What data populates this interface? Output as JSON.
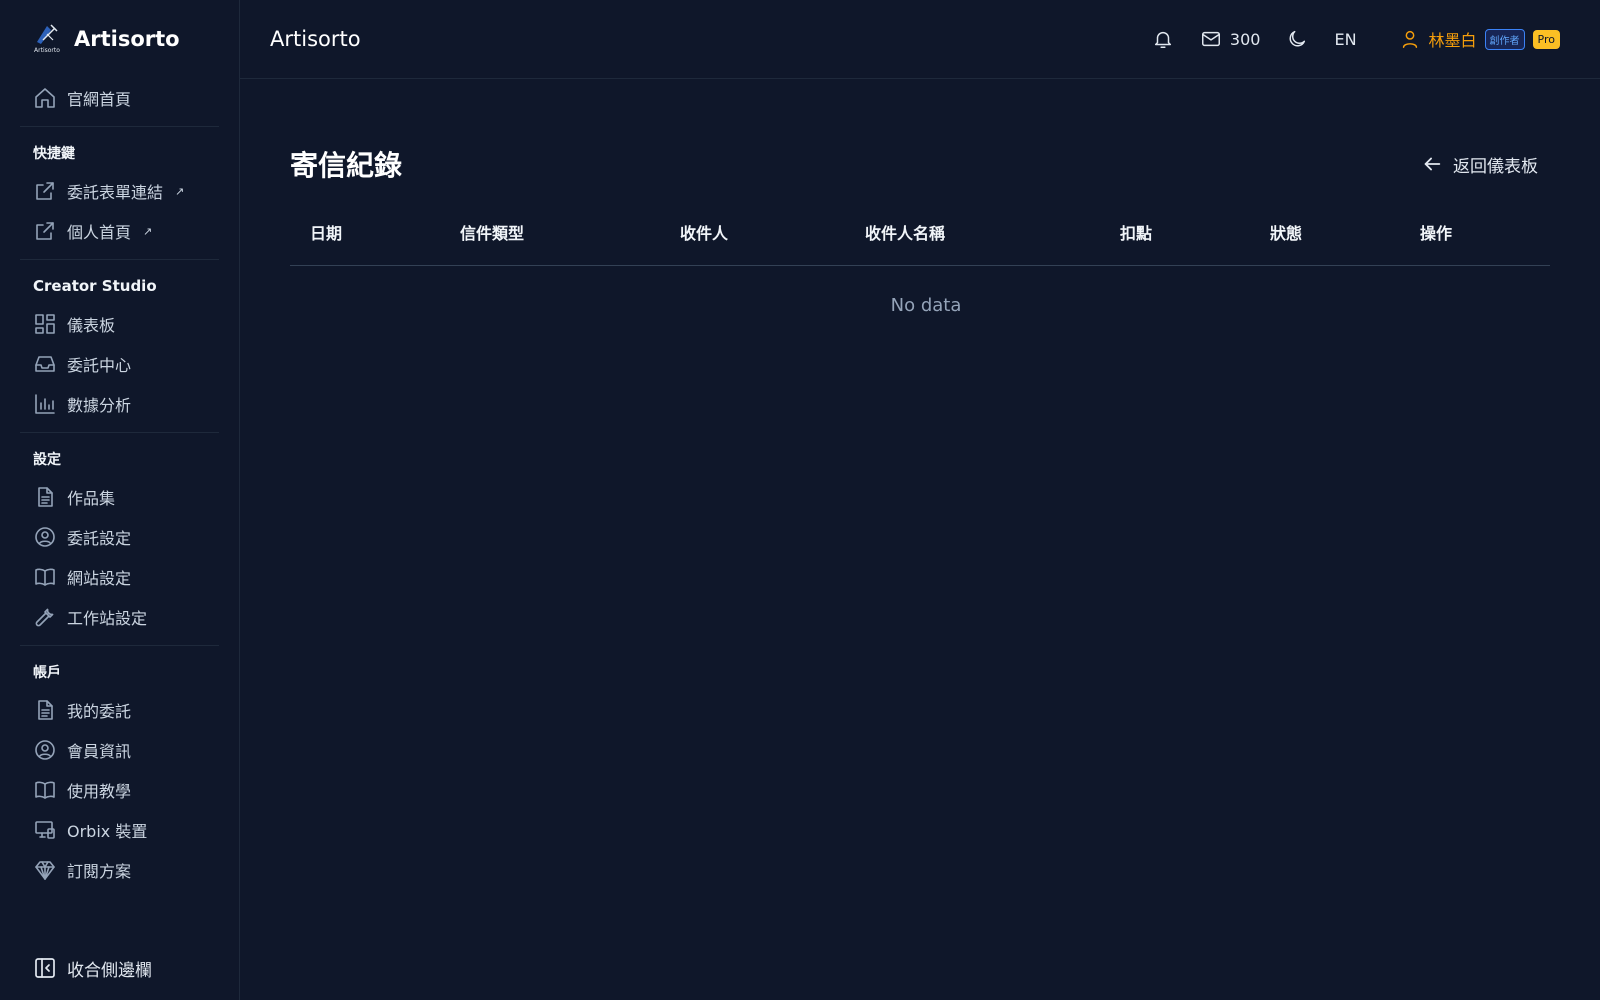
{
  "brand": {
    "name": "Artisorto",
    "logo_caption": "Artisorto"
  },
  "sidebar": {
    "home": "官網首頁",
    "sections": [
      {
        "title": "快捷鍵",
        "items": [
          {
            "label": "委託表單連結",
            "external": "↗"
          },
          {
            "label": "個人首頁",
            "external": "↗"
          }
        ]
      },
      {
        "title": "Creator Studio",
        "items": [
          {
            "label": "儀表板"
          },
          {
            "label": "委託中心"
          },
          {
            "label": "數據分析"
          }
        ]
      },
      {
        "title": "設定",
        "items": [
          {
            "label": "作品集"
          },
          {
            "label": "委託設定"
          },
          {
            "label": "網站設定"
          },
          {
            "label": "工作站設定"
          }
        ]
      },
      {
        "title": "帳戶",
        "items": [
          {
            "label": "我的委託"
          },
          {
            "label": "會員資訊"
          },
          {
            "label": "使用教學"
          },
          {
            "label": "Orbix 裝置"
          },
          {
            "label": "訂閱方案"
          }
        ]
      }
    ],
    "collapse": "收合側邊欄"
  },
  "topbar": {
    "title": "Artisorto",
    "mail_count": "300",
    "language": "EN",
    "user_name": "林墨白",
    "role_badge": "創作者",
    "plan_badge": "Pro"
  },
  "page": {
    "title": "寄信紀錄",
    "back_label": "返回儀表板"
  },
  "table": {
    "columns": [
      "日期",
      "信件類型",
      "收件人",
      "收件人名稱",
      "扣點",
      "狀態",
      "操作"
    ],
    "empty_text": "No data"
  },
  "colors": {
    "background": "#0f172a",
    "accent_user": "#f59e0b",
    "badge_pro": "#fbbf24",
    "badge_creator": "#3b82f6"
  },
  "icons": {
    "home": "home-icon",
    "external": "external-link-icon",
    "dashboard": "dashboard-icon",
    "inbox": "inbox-icon",
    "chart": "bar-chart-icon",
    "document": "document-icon",
    "user-circle": "user-circle-icon",
    "book": "book-icon",
    "wrench": "wrench-icon",
    "devices": "devices-icon",
    "diamond": "diamond-icon",
    "bell": "bell-icon",
    "mail": "mail-icon",
    "moon": "moon-icon",
    "user": "user-icon",
    "arrow-left": "arrow-left-icon",
    "collapse": "sidebar-collapse-icon"
  }
}
